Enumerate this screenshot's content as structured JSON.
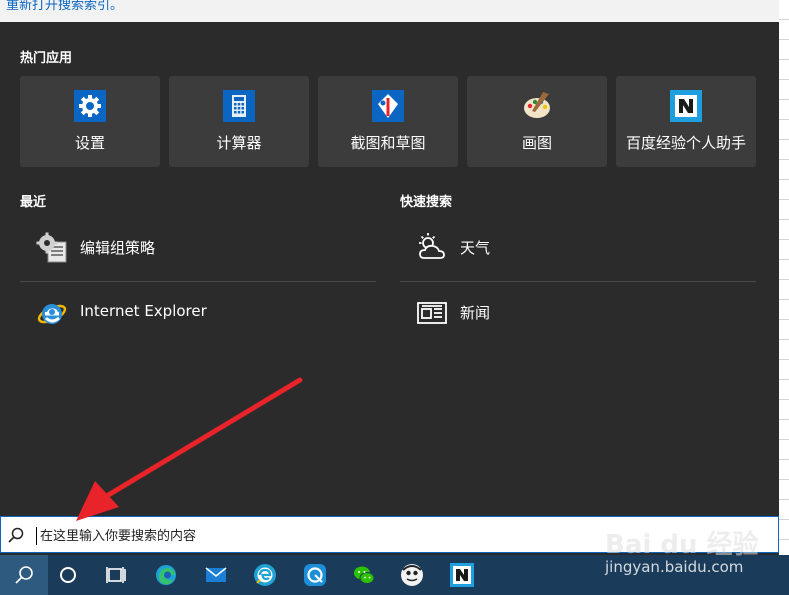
{
  "top_hint": {
    "text": "重新打开搜索索引。"
  },
  "top_apps": {
    "title": "热门应用",
    "items": [
      {
        "label": "设置",
        "icon": "gear-icon"
      },
      {
        "label": "计算器",
        "icon": "calculator-icon"
      },
      {
        "label": "截图和草图",
        "icon": "snip-sketch-icon"
      },
      {
        "label": "画图",
        "icon": "paint-palette-icon"
      },
      {
        "label": "百度经验个人助手",
        "icon": "baidu-jingyan-icon"
      }
    ]
  },
  "recent": {
    "title": "最近",
    "items": [
      {
        "label": "编辑组策略",
        "icon": "group-policy-icon"
      },
      {
        "label": "Internet Explorer",
        "icon": "internet-explorer-icon"
      }
    ]
  },
  "quick_search": {
    "title": "快速搜索",
    "items": [
      {
        "label": "天气",
        "icon": "weather-icon"
      },
      {
        "label": "新闻",
        "icon": "news-icon"
      }
    ]
  },
  "search": {
    "placeholder": "在这里输入你要搜索的内容"
  },
  "taskbar": {
    "items": [
      "search-icon",
      "cortana-icon",
      "task-view-icon",
      "edge-icon",
      "mail-icon",
      "browser-e-icon",
      "photo-app-icon",
      "wechat-icon",
      "avatar-app-icon",
      "baidu-jingyan-icon"
    ]
  },
  "watermark": {
    "logo": "Bai du 经验",
    "url": "jingyan.baidu.com"
  },
  "colors": {
    "panel_bg": "#2b2b2b",
    "tile_bg": "#3c3c3c",
    "accent": "#0a66c2",
    "taskbar_bg": "#1a3c5a",
    "arrow": "#e8232a"
  }
}
